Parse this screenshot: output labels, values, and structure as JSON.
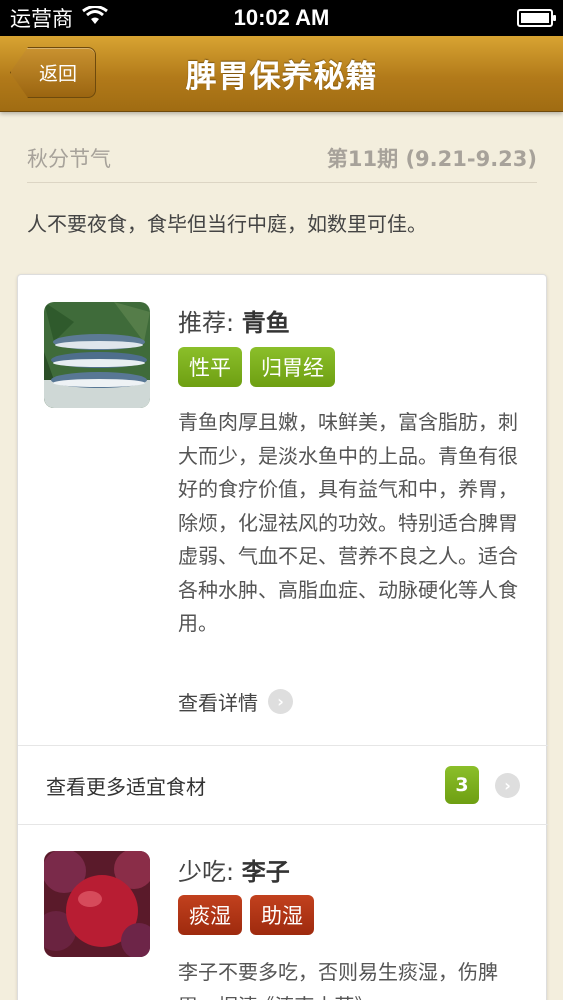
{
  "status_bar": {
    "carrier": "运营商",
    "time": "10:02 AM"
  },
  "nav": {
    "back_label": "返回",
    "title": "脾胃保养秘籍"
  },
  "period": {
    "solar_term": "秋分节气",
    "issue": "第11期 (9.21-9.23)"
  },
  "quote": "人不要夜食，食毕但当行中庭，如数里可佳。",
  "recommend": {
    "prefix": "推荐:",
    "name": "青鱼",
    "tags": [
      "性平",
      "归胃经"
    ],
    "description": "青鱼肉厚且嫩，味鲜美，富含脂肪，刺大而少，是淡水鱼中的上品。青鱼有很好的食疗价值，具有益气和中，养胃，除烦，化湿祛风的功效。特别适合脾胃虚弱、气血不足、营养不良之人。适合各种水肿、高脂血症、动脉硬化等人食用。",
    "detail_label": "查看详情"
  },
  "more_foods": {
    "label": "查看更多适宜食材",
    "count": "3"
  },
  "less": {
    "prefix": "少吃:",
    "name": "李子",
    "tags": [
      "痰湿",
      "助湿"
    ],
    "description": "李子不要多吃，否则易生痰湿，伤脾胃。据清·《滇南本草》"
  },
  "colors": {
    "nav_gold": "#b27a1a",
    "tag_green": "#7aaf1c",
    "tag_red": "#b3361a",
    "background": "#f3eedd"
  }
}
